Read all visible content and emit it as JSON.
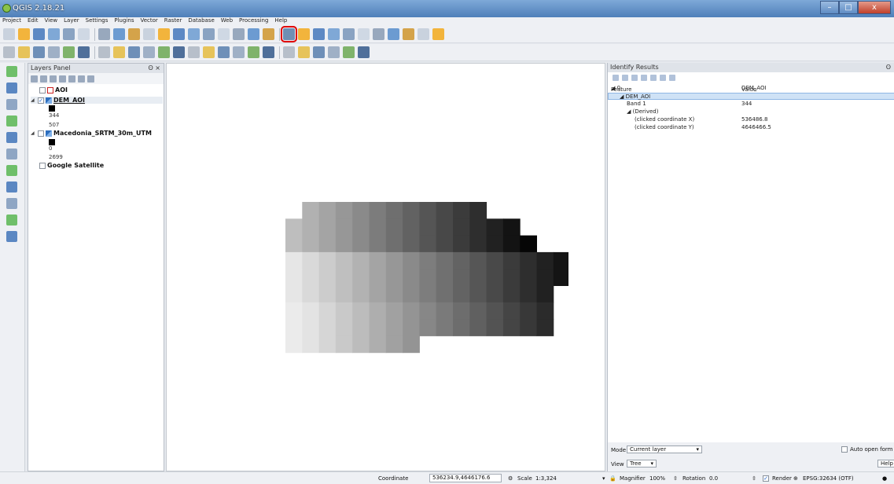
{
  "window": {
    "title": "QGIS 2.18.21",
    "min_glyph": "–",
    "max_glyph": "□",
    "close_glyph": "x"
  },
  "menu": [
    "Project",
    "Edit",
    "View",
    "Layer",
    "Settings",
    "Plugins",
    "Vector",
    "Raster",
    "Database",
    "Web",
    "Processing",
    "Help"
  ],
  "toolbar1": {
    "icons": [
      "new-project-icon",
      "open-project-icon",
      "save-project-icon",
      "save-as-icon",
      "print-composer-icon",
      "composer-manager-icon",
      "pan-icon",
      "pan-to-selection-icon",
      "zoom-in-icon",
      "zoom-out-icon",
      "zoom-full-icon",
      "zoom-to-selection-icon",
      "zoom-to-layer-icon",
      "zoom-last-icon",
      "zoom-next-icon",
      "new-map-view-icon",
      "bookmark-icon",
      "refresh-icon",
      "identify-features-icon",
      "select-features-icon",
      "deselect-icon",
      "select-by-expression-icon",
      "open-attribute-table-icon",
      "field-calculator-icon",
      "statistical-summary-icon",
      "measure-icon",
      "map-tips-icon",
      "text-annotation-icon",
      "help-icon"
    ],
    "highlighted": "identify-features-icon",
    "colors": {
      "highlight": "#e00000"
    }
  },
  "toolbar2": {
    "icons": [
      "current-edits-icon",
      "toggle-editing-icon",
      "save-edits-icon",
      "digitize-icon",
      "add-feature-icon",
      "move-feature-icon",
      "node-tool-icon",
      "delete-selected-icon",
      "cut-features-icon",
      "copy-features-icon",
      "paste-features-icon",
      "label-icon",
      "pin-labels-icon",
      "show-hide-labels-icon",
      "move-label-icon",
      "rotate-label-icon",
      "change-label-icon",
      "label-properties-icon",
      "plugin-icon",
      "csv-icon",
      "grass-icon",
      "raster-calc-icon",
      "terrain-icon",
      "python-icon"
    ]
  },
  "left_toolbar": {
    "icons": [
      "add-vector-layer-icon",
      "add-raster-layer-icon",
      "add-postgis-layer-icon",
      "add-spatialite-layer-icon",
      "add-mssql-layer-icon",
      "add-wms-layer-icon",
      "add-wcs-layer-icon",
      "add-wfs-layer-icon",
      "add-delimited-text-icon",
      "new-shapefile-layer-icon",
      "new-temporary-layer-icon"
    ]
  },
  "layers_panel": {
    "title": "Layers Panel",
    "controls": "ʘ ×",
    "layers": [
      {
        "name": "AOI",
        "checked": false,
        "swatch": "#ffffff"
      },
      {
        "name": "DEM_AOI",
        "checked": true,
        "max": "344",
        "min": "507"
      },
      {
        "name": "Macedonia_SRTM_30m_UTM",
        "checked": false,
        "max": "0",
        "min": "2699"
      },
      {
        "name": "Google Satellite",
        "checked": false
      }
    ],
    "colors": {
      "aoi_outline": "#cc2020",
      "dem_icon": "#2e6fbf"
    }
  },
  "identify_panel": {
    "title": "Identify Results",
    "controls": "ʘ",
    "columns": [
      "Feature",
      "Value"
    ],
    "rows": [
      {
        "feature": "0",
        "value": "DEM_AOI",
        "level": 0
      },
      {
        "feature": "DEM_AOI",
        "value": "",
        "level": 1,
        "selected": true
      },
      {
        "feature": "Band 1",
        "value": "344",
        "level": 2
      },
      {
        "feature": "(Derived)",
        "value": "",
        "level": 2
      },
      {
        "feature": "(clicked coordinate X)",
        "value": "536486.8",
        "level": 3
      },
      {
        "feature": "(clicked coordinate Y)",
        "value": "4646466.5",
        "level": 3
      }
    ],
    "mode_label": "Mode",
    "mode_value": "Current layer",
    "view_label": "View",
    "view_value": "Tree",
    "auto_open_label": "Auto open form",
    "help_label": "Help"
  },
  "raster": {
    "rows": [
      "......ffffffffffff.....",
      "...........................",
      "fffffffffffffffff.........",
      "ffffffffffffffffff........",
      "ffffffffffffffffff........"
    ]
  },
  "status": {
    "coordinate_label": "Coordinate",
    "coordinate_value": "536234.9,4646176.6",
    "scale_label": "Scale",
    "scale_value": "1:3,324",
    "magnifier_label": "Magnifier",
    "magnifier_value": "100%",
    "rotation_label": "Rotation",
    "rotation_value": "0.0",
    "render_label": "Render",
    "crs": "EPSG:32634 (OTF)"
  }
}
